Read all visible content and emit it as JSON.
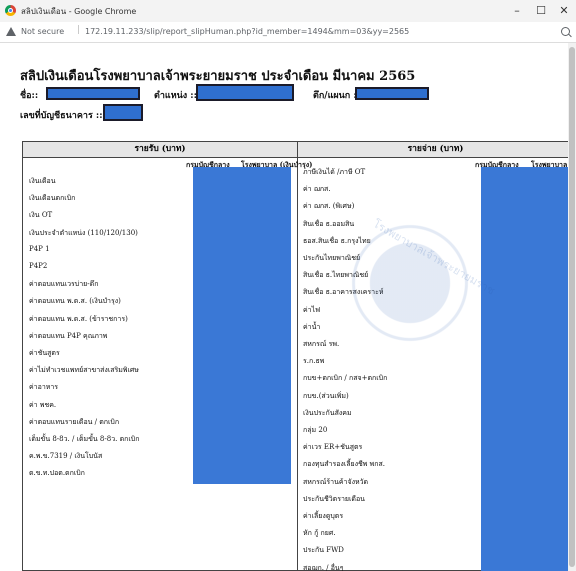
{
  "browser": {
    "tab_title": "สลิปเงินเดือน - Google Chrome",
    "security_label": "Not secure",
    "url": "172.19.11.233/slip/report_slipHuman.php?id_member=1494&mm=03&yy=2565",
    "minimize": "–",
    "maximize": "☐",
    "close": "✕"
  },
  "slip": {
    "title": "สลิปเงินเดือนโรงพยาบาลเจ้าพระยายมราช ประจำเดือน มีนาคม 2565",
    "name_label": "ชื่อ::",
    "position_label": "ตำแหน่ง ::",
    "department_label": "ตึก/แผนก ::",
    "account_label": "เลขที่บัญชีธนาคาร ::",
    "watermark_text": "โรงพยาบาลเจ้าพระยายมราช"
  },
  "income": {
    "header": "รายรับ (บาท)",
    "col_central": "กรมบัญชีกลาง",
    "col_hospital": "โรงพยาบาล (เงินบำรุง)",
    "items": [
      "เงินเดือน",
      "เงินเดือนตกเบิก",
      "เงิน OT",
      "เงินประจำตำแหน่ง (110/120/130)",
      "P4P 1",
      "P4P2",
      "ค่าตอบแทนเวรบ่าย-ดึก",
      "ค่าตอบแทน พ.ต.ส. (เงินบำรุง)",
      "ค่าตอบแทน พ.ต.ส. (ข้าราชการ)",
      "ค่าตอบแทน P4P คุณภาพ",
      "ค่าชันสูตร",
      "ค่าไม่ทำเวชแพทย์สาขาส่งเสริมพิเศษ",
      "ค่าอาหาร",
      "ค่า พชค.",
      "ค่าตอบแทนรายเดือน / ตกเบิก",
      "เต็มขั้น 8-8ว. / เต็มขั้น 8-8ว. ตกเบิก",
      "ค.พ.ข.7319 / เงินโบนัส",
      "ต.ข.ท.ปอต.ตกเบิก"
    ]
  },
  "deductions": {
    "header": "รายจ่าย (บาท)",
    "col_central": "กรมบัญชีกลาง",
    "col_hospital": "โรงพยาบาล",
    "items": [
      "ภาษีเงินได้ /ภาษี OT",
      "ค่า ฌกส.",
      "ค่า ฌกส. (พิเศษ)",
      "สินเชื่อ ธ.ออมสิน",
      "ธอส.สินเชื่อ ธ.กรุงไทย",
      "ประกันไทยพาณิชย์",
      "สินเชื่อ ธ.ไทยพาณิชย์",
      "สินเชื่อ ธ.อาคารสงเคราะห์",
      "ค่าไฟ",
      "ค่าน้ำ",
      "สหกรณ์ รพ.",
      "ร.ก.ธพ",
      "กบข+ตกเบิก / กสจ+ตกเบิก",
      "กบข.(ส่วนเพิ่ม)",
      "เงินประกันสังคม",
      "กลุ่ม 20",
      "ค่าเวร ER+ชันสูตร",
      "กองทุนสำรองเลี้ยงชีพ พกส.",
      "สหกรณ์ร้านค้าจังหวัด",
      "ประกันชีวิตรายเดือน",
      "ค่าเลี้ยงดูบุตร",
      "หัก กู้ กยศ.",
      "ประกัน FWD",
      "สอฌก. / อื่นๆ"
    ]
  },
  "colors": {
    "redaction": "#2f6fcf",
    "column_block": "#3a78d6"
  }
}
